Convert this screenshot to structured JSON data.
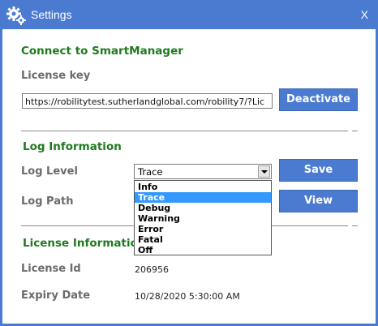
{
  "window": {
    "title": "Settings",
    "close_label": "X"
  },
  "connect": {
    "title": "Connect to SmartManager",
    "license_key_label": "License key",
    "license_key_value": "https://robilitytest.sutherlandglobal.com/robility7/?Lic",
    "deactivate_label": "Deactivate"
  },
  "log": {
    "title": "Log Information",
    "level_label": "Log Level",
    "level_selected": "Trace",
    "path_label": "Log Path",
    "save_label": "Save",
    "view_label": "View",
    "options": [
      "Info",
      "Trace",
      "Debug",
      "Warning",
      "Error",
      "Fatal",
      "Off"
    ],
    "highlighted_option": "Trace"
  },
  "license": {
    "title": "License Information",
    "id_label": "License Id",
    "id_value": "206956",
    "expiry_label": "Expiry Date",
    "expiry_value": "10/28/2020 5:30:00 AM"
  },
  "colors": {
    "accent": "#4a7bd0",
    "section_title": "#1e7a1e",
    "selection": "#3399ff"
  }
}
